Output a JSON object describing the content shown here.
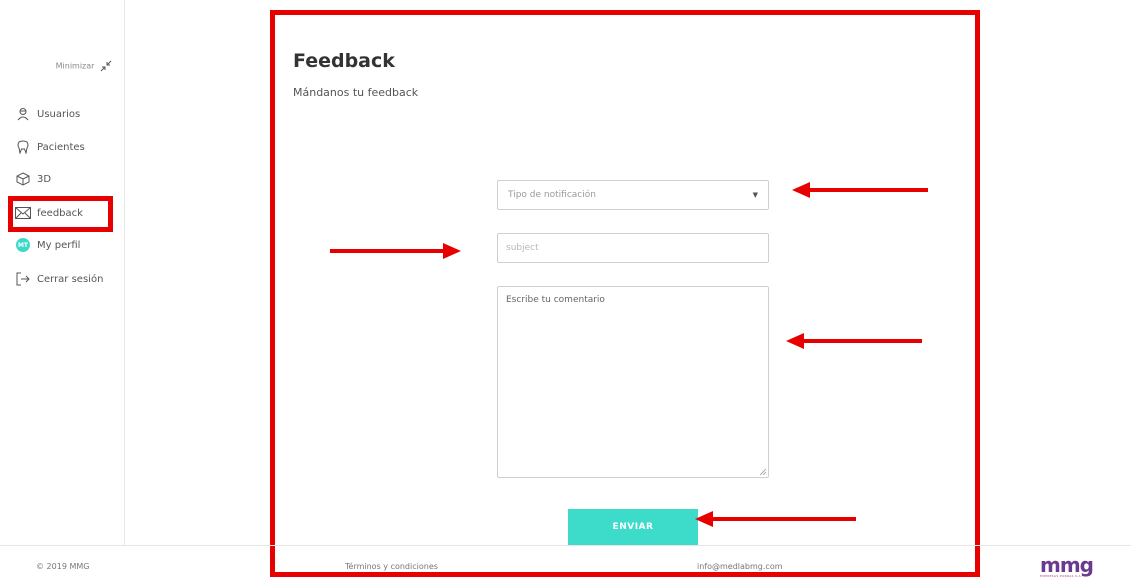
{
  "sidebar": {
    "minimize_label": "Minimizar",
    "items": [
      {
        "label": "Usuarios",
        "icon": "user-icon"
      },
      {
        "label": "Pacientes",
        "icon": "tooth-icon"
      },
      {
        "label": "3D",
        "icon": "cube-icon"
      },
      {
        "label": "feedback",
        "icon": "envelope-icon"
      },
      {
        "label": "My perfil",
        "icon": "avatar-icon",
        "avatar_initials": "MT"
      },
      {
        "label": "Cerrar sesión",
        "icon": "logout-icon"
      }
    ]
  },
  "page": {
    "title": "Feedback",
    "subtitle": "Mándanos tu feedback"
  },
  "form": {
    "notification_type_placeholder": "Tipo de notificación",
    "subject_placeholder": "subject",
    "comment_placeholder": "Escribe tu comentario",
    "send_label": "ENVIAR"
  },
  "footer": {
    "copyright": "© 2019 MMG",
    "terms": "Términos y condiciones",
    "email": "info@medlabmg.com",
    "logo": "mmg",
    "logo_tagline": "EMPRESAS PORRAS S.A."
  },
  "colors": {
    "accent": "#3ddcca",
    "annotation": "#e60000",
    "brand": "#6b3a8f"
  }
}
